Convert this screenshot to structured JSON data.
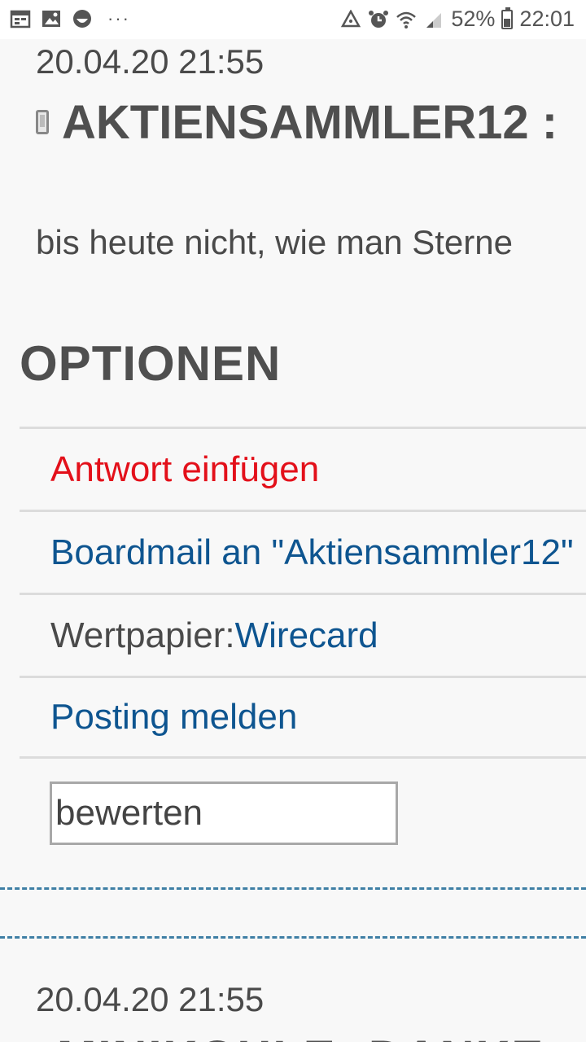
{
  "status_bar": {
    "left_icons": [
      "calendar-icon",
      "gallery-icon",
      "face-icon"
    ],
    "dots": "···",
    "right_icons": [
      "recycle-icon",
      "alarm-icon",
      "wifi-icon",
      "signal-icon"
    ],
    "battery_level": 52,
    "battery": "52%",
    "time": "22:01"
  },
  "post": {
    "date": "20.04.20 21:55",
    "author": "AKTIENSAMMLER12 :",
    "text": "bis heute nicht, wie man Sterne"
  },
  "options": {
    "title": "OPTIONEN",
    "reply": "Antwort einfügen",
    "boardmail": "Boardmail an \"Aktiensammler12\"",
    "security_prefix": "Wertpapier: ",
    "security_link": "Wirecard",
    "report": "Posting melden",
    "rate_value": "bewerten"
  },
  "next_post": {
    "date": "20.04.20 21:55",
    "author_partial": "MINIKOHLE: DANKE"
  },
  "colors": {
    "reply": "#e3101a",
    "link": "#0e5590",
    "separator": "#3f7fa5"
  }
}
